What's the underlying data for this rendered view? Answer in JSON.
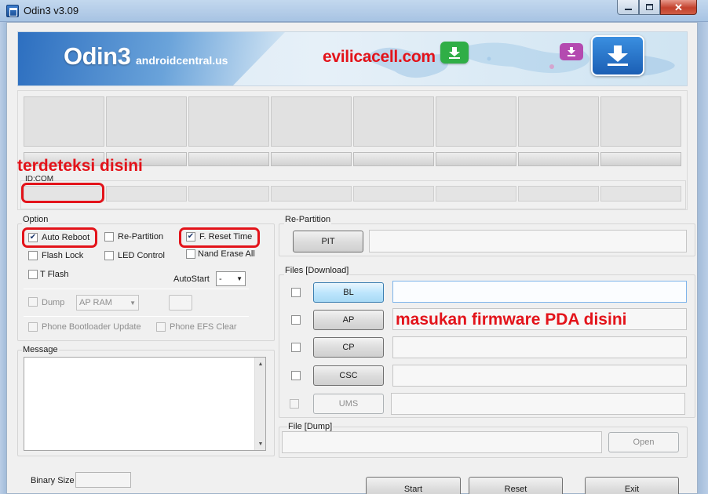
{
  "window": {
    "title": "Odin3 v3.09"
  },
  "banner": {
    "logo": "Odin3",
    "site": "androidcentral.us",
    "watermark": "evilicacell.com"
  },
  "annotations": {
    "detected": "terdeteksi disini",
    "firmware": "masukan firmware PDA disini"
  },
  "ports": {
    "id_com_label": "ID:COM",
    "count": 8
  },
  "option": {
    "title": "Option",
    "auto_reboot": {
      "label": "Auto Reboot",
      "checked": true
    },
    "re_partition": {
      "label": "Re-Partition",
      "checked": false
    },
    "f_reset_time": {
      "label": "F. Reset Time",
      "checked": true
    },
    "flash_lock": {
      "label": "Flash Lock",
      "checked": false
    },
    "led_control": {
      "label": "LED Control",
      "checked": false
    },
    "nand_erase_all": {
      "label": "Nand Erase All",
      "checked": false
    },
    "t_flash": {
      "label": "T Flash",
      "checked": false
    },
    "autostart_label": "AutoStart",
    "autostart_value": "-",
    "dump_label": "Dump",
    "dump_select": "AP RAM",
    "phone_bootloader_update": "Phone Bootloader Update",
    "phone_efs_clear": "Phone EFS Clear"
  },
  "message": {
    "title": "Message"
  },
  "binary_size_label": "Binary Size",
  "repartition": {
    "title": "Re-Partition",
    "pit_button": "PIT"
  },
  "files": {
    "title": "Files [Download]",
    "rows": [
      {
        "button": "BL"
      },
      {
        "button": "AP"
      },
      {
        "button": "CP"
      },
      {
        "button": "CSC"
      },
      {
        "button": "UMS"
      }
    ]
  },
  "file_dump": {
    "title": "File [Dump]",
    "open_button": "Open"
  },
  "actions": {
    "start": "Start",
    "reset": "Reset",
    "exit": "Exit"
  },
  "colors": {
    "annotation": "#e3131a",
    "accent_blue": "#3c7fb1"
  }
}
